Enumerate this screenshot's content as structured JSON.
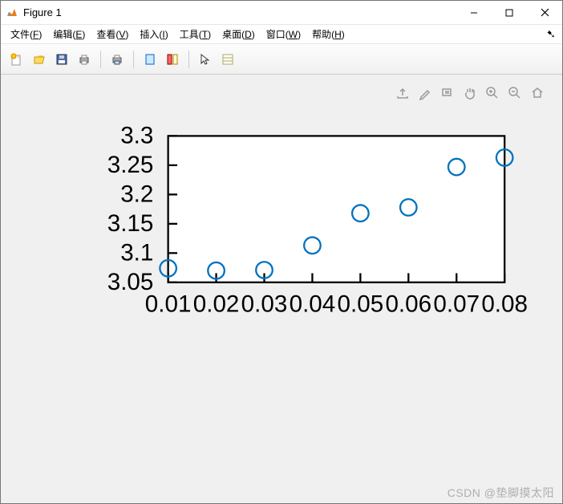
{
  "window": {
    "title": "Figure 1"
  },
  "menu": {
    "file": "文件(F)",
    "edit": "编辑(E)",
    "view": "查看(V)",
    "insert": "插入(I)",
    "tools": "工具(T)",
    "desktop": "桌面(D)",
    "window": "窗口(W)",
    "help": "帮助(H)"
  },
  "toolbar_icons": {
    "new": "new-figure-icon",
    "open": "open-icon",
    "save": "save-icon",
    "print": "print-icon",
    "print_preview": "print-preview-icon",
    "linked": "link-icon",
    "colorbar": "colorbar-icon",
    "pointer": "pointer-icon",
    "data_cursor": "data-cursor-icon"
  },
  "axes_toolbar_icons": {
    "export": "export-icon",
    "brush": "brush-icon",
    "restore": "insert-legend-icon",
    "pan": "pan-icon",
    "zoom_in": "zoom-in-icon",
    "zoom_out": "zoom-out-icon",
    "home": "home-icon"
  },
  "chart_data": {
    "type": "scatter",
    "x": [
      0.01,
      0.02,
      0.03,
      0.04,
      0.05,
      0.06,
      0.07,
      0.08
    ],
    "y": [
      3.074,
      3.07,
      3.071,
      3.113,
      3.168,
      3.178,
      3.247,
      3.263
    ],
    "xlim": [
      0.01,
      0.08
    ],
    "ylim": [
      3.05,
      3.3
    ],
    "xticks": [
      0.01,
      0.02,
      0.03,
      0.04,
      0.05,
      0.06,
      0.07,
      0.08
    ],
    "yticks": [
      3.05,
      3.1,
      3.15,
      3.2,
      3.25,
      3.3
    ],
    "xtick_labels": [
      "0.01",
      "0.02",
      "0.03",
      "0.04",
      "0.05",
      "0.06",
      "0.07",
      "0.08"
    ],
    "ytick_labels": [
      "3.05",
      "3.1",
      "3.15",
      "3.2",
      "3.25",
      "3.3"
    ],
    "marker_color": "#0072BD",
    "title": "",
    "xlabel": "",
    "ylabel": ""
  },
  "watermark": "CSDN @垫脚摸太阳"
}
